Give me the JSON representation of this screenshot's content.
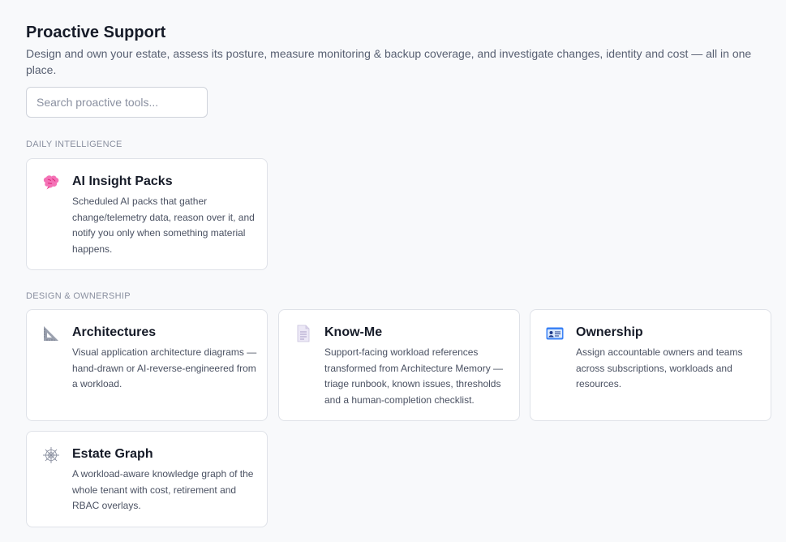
{
  "header": {
    "title": "Proactive Support",
    "subtitle": "Design and own your estate, assess its posture, measure monitoring & backup coverage, and investigate changes, identity and cost — all in one place."
  },
  "search": {
    "placeholder": "Search proactive tools...",
    "value": ""
  },
  "sections": [
    {
      "label": "DAILY INTELLIGENCE",
      "cards": [
        {
          "icon": "brain-icon",
          "title": "AI Insight Packs",
          "description": "Scheduled AI packs that gather change/telemetry data, reason over it, and notify you only when something material happens."
        }
      ]
    },
    {
      "label": "DESIGN & OWNERSHIP",
      "cards": [
        {
          "icon": "triangle-ruler-icon",
          "title": "Architectures",
          "description": "Visual application architecture diagrams — hand-drawn or AI-reverse-engineered from a workload."
        },
        {
          "icon": "document-icon",
          "title": "Know-Me",
          "description": "Support-facing workload references transformed from Architecture Memory — triage runbook, known issues, thresholds and a human-completion checklist."
        },
        {
          "icon": "id-card-icon",
          "title": "Ownership",
          "description": "Assign accountable owners and teams across subscriptions, workloads and resources."
        },
        {
          "icon": "spider-web-icon",
          "title": "Estate Graph",
          "description": "A workload-aware knowledge graph of the whole tenant with cost, retirement and RBAC overlays."
        }
      ]
    }
  ]
}
